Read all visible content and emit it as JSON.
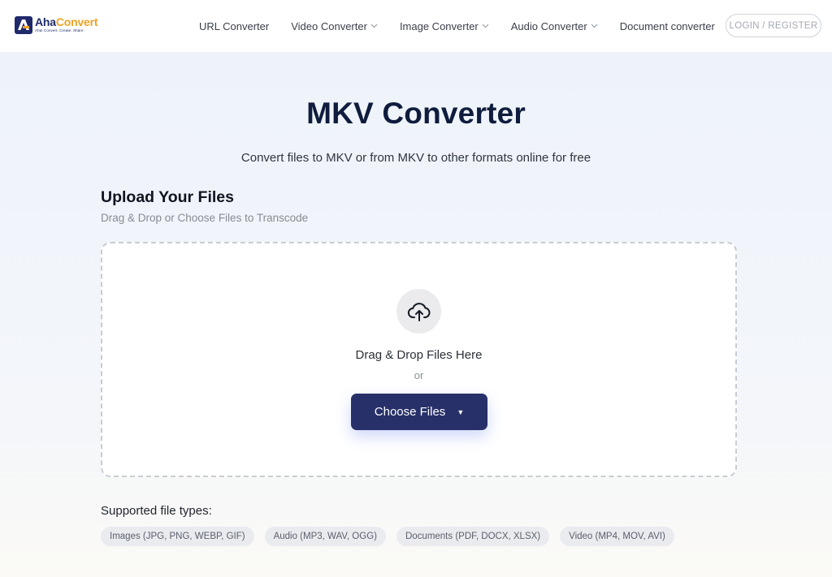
{
  "header": {
    "logo": {
      "name_part1": "Aha",
      "name_part2": "Convert",
      "tagline": "Aha! Convert. Create. Share."
    },
    "nav": [
      {
        "label": "URL Converter",
        "has_dropdown": false
      },
      {
        "label": "Video Converter",
        "has_dropdown": true
      },
      {
        "label": "Image Converter",
        "has_dropdown": true
      },
      {
        "label": "Audio Converter",
        "has_dropdown": true
      },
      {
        "label": "Document converter",
        "has_dropdown": false
      }
    ],
    "login_label": "LOGIN / REGISTER"
  },
  "main": {
    "title": "MKV Converter",
    "subtitle": "Convert files to MKV or from MKV to other formats online for free",
    "upload": {
      "heading": "Upload Your Files",
      "subheading": "Drag & Drop or Choose Files to Transcode",
      "drop_text": "Drag & Drop Files Here",
      "or_text": "or",
      "choose_label": "Choose Files",
      "caret": "▼"
    },
    "supported": {
      "label": "Supported file types:",
      "types": [
        "Images (JPG, PNG, WEBP, GIF)",
        "Audio (MP3, WAV, OGG)",
        "Documents (PDF, DOCX, XLSX)",
        "Video (MP4, MOV, AVI)"
      ]
    }
  },
  "icons": {
    "upload": "cloud-upload-icon",
    "chevron": "chevron-down-icon",
    "logo": "aha-convert-logo"
  },
  "colors": {
    "brand_navy": "#1f2a6b",
    "brand_orange": "#f0a323",
    "button_bg": "#273069",
    "title": "#0f1c3d"
  }
}
